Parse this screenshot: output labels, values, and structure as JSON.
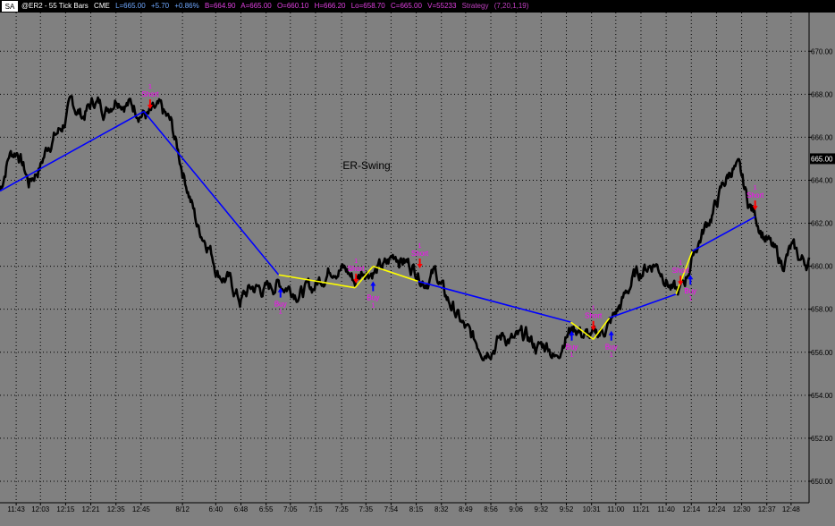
{
  "header": {
    "sa_label": "SA",
    "symbol": "@ER2 - 55 Tick Bars",
    "exchange": "CME",
    "last": "L=665.00",
    "change": "+5.70",
    "pct": "+0.86%",
    "bid": "B=664.90",
    "ask": "A=665.00",
    "open": "O=660.10",
    "high": "H=666.20",
    "low": "Lo=658.70",
    "close": "C=665.00",
    "volume": "V=55233",
    "strategy": "Strategy",
    "params": "(7,20,1,19)"
  },
  "colors": {
    "background": "#808080",
    "price_line": "#000000",
    "swing_blue": "#0000ff",
    "swing_yellow": "#ffff00",
    "signal_label": "#ff00ff",
    "buy_arrow": "#0000ff",
    "short_arrow": "#ff0000",
    "current_price_box": "#000000"
  },
  "chart_data": {
    "type": "line",
    "title": "ER-Swing",
    "ylim": [
      649,
      671.8
    ],
    "yticks": [
      650,
      652,
      654,
      656,
      658,
      660,
      662,
      664,
      666,
      668,
      670
    ],
    "ytick_labels": [
      "650.00",
      "652.00",
      "654.00",
      "656.00",
      "658.00",
      "660.00",
      "662.00",
      "664.00",
      "666.00",
      "668.00",
      "670.00"
    ],
    "current_price": 665.0,
    "current_price_label": "665.00",
    "bar_count": 900,
    "x_ticks": [
      {
        "bar": 18,
        "label": "11:43"
      },
      {
        "bar": 45,
        "label": "12:03"
      },
      {
        "bar": 73,
        "label": "12:15"
      },
      {
        "bar": 101,
        "label": "12:21"
      },
      {
        "bar": 129,
        "label": "12:35"
      },
      {
        "bar": 157,
        "label": "12:45"
      },
      {
        "bar": 203,
        "label": "8/12"
      },
      {
        "bar": 240,
        "label": "6:40"
      },
      {
        "bar": 268,
        "label": "6:48"
      },
      {
        "bar": 296,
        "label": "6:55"
      },
      {
        "bar": 323,
        "label": "7:05"
      },
      {
        "bar": 351,
        "label": "7:15"
      },
      {
        "bar": 380,
        "label": "7:25"
      },
      {
        "bar": 407,
        "label": "7:35"
      },
      {
        "bar": 435,
        "label": "7:54"
      },
      {
        "bar": 463,
        "label": "8:15"
      },
      {
        "bar": 491,
        "label": "8:32"
      },
      {
        "bar": 518,
        "label": "8:49"
      },
      {
        "bar": 546,
        "label": "8:56"
      },
      {
        "bar": 574,
        "label": "9:06"
      },
      {
        "bar": 602,
        "label": "9:32"
      },
      {
        "bar": 630,
        "label": "9:52"
      },
      {
        "bar": 658,
        "label": "10:31"
      },
      {
        "bar": 685,
        "label": "11:00"
      },
      {
        "bar": 713,
        "label": "11:21"
      },
      {
        "bar": 741,
        "label": "11:40"
      },
      {
        "bar": 769,
        "label": "12:14"
      },
      {
        "bar": 797,
        "label": "12:24"
      },
      {
        "bar": 825,
        "label": "12:30"
      },
      {
        "bar": 853,
        "label": "12:37"
      },
      {
        "bar": 880,
        "label": "12:48"
      }
    ],
    "price_anchors": [
      [
        0,
        663.5
      ],
      [
        10,
        665.2
      ],
      [
        20,
        665.4
      ],
      [
        32,
        663.9
      ],
      [
        45,
        664.7
      ],
      [
        55,
        665.8
      ],
      [
        68,
        666.4
      ],
      [
        80,
        667.5
      ],
      [
        92,
        667.0
      ],
      [
        105,
        667.7
      ],
      [
        118,
        667.3
      ],
      [
        130,
        668.0
      ],
      [
        142,
        667.6
      ],
      [
        155,
        667.3
      ],
      [
        165,
        667.0
      ],
      [
        178,
        667.2
      ],
      [
        190,
        666.6
      ],
      [
        200,
        665.0
      ],
      [
        210,
        663.5
      ],
      [
        220,
        661.8
      ],
      [
        232,
        661.1
      ],
      [
        242,
        659.8
      ],
      [
        255,
        659.3
      ],
      [
        267,
        658.4
      ],
      [
        280,
        659.0
      ],
      [
        295,
        658.9
      ],
      [
        308,
        659.2
      ],
      [
        320,
        659.1
      ],
      [
        335,
        658.8
      ],
      [
        348,
        659.0
      ],
      [
        360,
        659.6
      ],
      [
        372,
        660.1
      ],
      [
        385,
        659.8
      ],
      [
        395,
        659.3
      ],
      [
        405,
        659.9
      ],
      [
        418,
        659.8
      ],
      [
        430,
        660.0
      ],
      [
        440,
        660.6
      ],
      [
        452,
        660.2
      ],
      [
        462,
        659.9
      ],
      [
        472,
        659.4
      ],
      [
        485,
        659.7
      ],
      [
        495,
        658.6
      ],
      [
        505,
        658.0
      ],
      [
        515,
        657.2
      ],
      [
        525,
        656.6
      ],
      [
        538,
        656.2
      ],
      [
        550,
        656.4
      ],
      [
        560,
        656.8
      ],
      [
        572,
        656.5
      ],
      [
        585,
        656.7
      ],
      [
        598,
        656.2
      ],
      [
        610,
        656.4
      ],
      [
        618,
        655.7
      ],
      [
        628,
        656.8
      ],
      [
        640,
        657.2
      ],
      [
        650,
        656.8
      ],
      [
        660,
        656.6
      ],
      [
        670,
        657.0
      ],
      [
        680,
        657.4
      ],
      [
        692,
        658.3
      ],
      [
        704,
        659.4
      ],
      [
        716,
        659.9
      ],
      [
        728,
        660.2
      ],
      [
        740,
        659.6
      ],
      [
        748,
        658.9
      ],
      [
        755,
        658.7
      ],
      [
        762,
        659.3
      ],
      [
        772,
        660.7
      ],
      [
        782,
        661.6
      ],
      [
        795,
        662.7
      ],
      [
        805,
        663.8
      ],
      [
        815,
        664.6
      ],
      [
        822,
        664.4
      ],
      [
        832,
        663.0
      ],
      [
        840,
        662.4
      ],
      [
        850,
        661.5
      ],
      [
        860,
        660.7
      ],
      [
        870,
        660.1
      ],
      [
        880,
        660.8
      ],
      [
        890,
        660.3
      ],
      [
        900,
        660.2
      ]
    ],
    "swing_segments": [
      {
        "from": [
          0,
          663.5
        ],
        "to": [
          160,
          667.2
        ],
        "color": "blue"
      },
      {
        "from": [
          160,
          667.2
        ],
        "to": [
          310,
          659.6
        ],
        "color": "blue"
      },
      {
        "from": [
          310,
          659.6
        ],
        "to": [
          395,
          659.0
        ],
        "color": "yellow"
      },
      {
        "from": [
          395,
          659.0
        ],
        "to": [
          415,
          660.0
        ],
        "color": "yellow"
      },
      {
        "from": [
          415,
          660.0
        ],
        "to": [
          465,
          659.3
        ],
        "color": "yellow"
      },
      {
        "from": [
          465,
          659.3
        ],
        "to": [
          635,
          657.4
        ],
        "color": "blue"
      },
      {
        "from": [
          635,
          657.4
        ],
        "to": [
          660,
          656.6
        ],
        "color": "yellow"
      },
      {
        "from": [
          660,
          656.6
        ],
        "to": [
          678,
          657.6
        ],
        "color": "yellow"
      },
      {
        "from": [
          678,
          657.6
        ],
        "to": [
          752,
          658.7
        ],
        "color": "blue"
      },
      {
        "from": [
          752,
          658.7
        ],
        "to": [
          770,
          660.7
        ],
        "color": "yellow"
      },
      {
        "from": [
          770,
          660.7
        ],
        "to": [
          840,
          662.3
        ],
        "color": "blue"
      }
    ],
    "signals": [
      {
        "bar": 167,
        "price": 667.3,
        "type": "short",
        "label": "Short",
        "qty": "1"
      },
      {
        "bar": 312,
        "price": 659.0,
        "type": "buy",
        "label": "Buy",
        "qty": "1"
      },
      {
        "bar": 396,
        "price": 659.2,
        "type": "short",
        "label": "Short",
        "qty": "1"
      },
      {
        "bar": 415,
        "price": 659.3,
        "type": "buy",
        "label": "Buy",
        "qty": "1"
      },
      {
        "bar": 467,
        "price": 659.9,
        "type": "short",
        "label": "Short",
        "qty": "1"
      },
      {
        "bar": 636,
        "price": 657.0,
        "type": "buy",
        "label": "Buy",
        "qty": "1"
      },
      {
        "bar": 660,
        "price": 657.0,
        "type": "short",
        "label": "Short",
        "qty": "1"
      },
      {
        "bar": 680,
        "price": 657.0,
        "type": "buy",
        "label": "Buy",
        "qty": "1"
      },
      {
        "bar": 757,
        "price": 659.1,
        "type": "short",
        "label": "Short",
        "qty": "1"
      },
      {
        "bar": 768,
        "price": 659.6,
        "type": "buy",
        "label": "Buy",
        "qty": "1"
      },
      {
        "bar": 840,
        "price": 662.6,
        "type": "short",
        "label": "Short",
        "qty": "1"
      }
    ]
  }
}
